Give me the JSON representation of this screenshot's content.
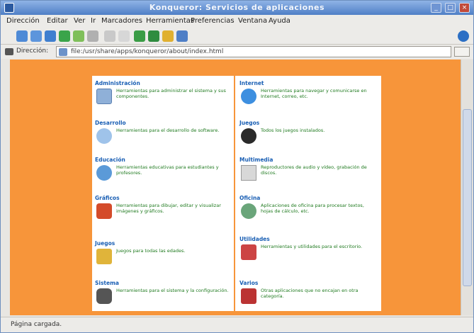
{
  "window": {
    "title": "Konqueror: Servicios de aplicaciones"
  },
  "menubar": [
    "Dirección",
    "Editar",
    "Ver",
    "Ir",
    "Marcadores",
    "Herramientas",
    "Preferencias",
    "Ventana",
    "Ayuda"
  ],
  "locbar": {
    "label": "Dirección:",
    "url": "file:/usr/share/apps/konqueror/about/index.html"
  },
  "left": [
    {
      "title": "Administración",
      "desc": "Herramientas para administrar el sistema y sus componentes.",
      "icon": "admin-icon"
    },
    {
      "title": "Desarrollo",
      "desc": "Herramientas para el desarrollo de software.",
      "icon": "develop-icon"
    },
    {
      "title": "Educación",
      "desc": "Herramientas educativas para estudiantes y profesores.",
      "icon": "education-icon"
    },
    {
      "title": "Gráficos",
      "desc": "Herramientas para dibujar, editar y visualizar imágenes y gráficos.",
      "icon": "graphics-icon"
    },
    {
      "title": "Juegos",
      "desc": "Juegos para todas las edades.",
      "icon": "games-icon"
    },
    {
      "title": "Sistema",
      "desc": "Herramientas para el sistema y la configuración.",
      "icon": "system-icon"
    }
  ],
  "right": [
    {
      "title": "Internet",
      "desc": "Herramientas para navegar y comunicarse en Internet, correo, etc.",
      "icon": "internet-icon"
    },
    {
      "title": "Juegos",
      "desc": "Todos los juegos instalados.",
      "icon": "bomb-icon"
    },
    {
      "title": "Multimedia",
      "desc": "Reproductores de audio y vídeo, grabación de discos.",
      "icon": "multimedia-icon"
    },
    {
      "title": "Oficina",
      "desc": "Aplicaciones de oficina para procesar textos, hojas de cálculo, etc.",
      "icon": "office-icon"
    },
    {
      "title": "Utilidades",
      "desc": "Herramientas y utilidades para el escritorio.",
      "icon": "utility-icon"
    },
    {
      "title": "Varios",
      "desc": "Otras aplicaciones que no encajan en otra categoría.",
      "icon": "misc-icon"
    }
  ],
  "status": {
    "text": "Página cargada."
  },
  "colors": {
    "content_bg": "#f7953a",
    "heading": "#1a5fb4",
    "desc": "#1f7a1f"
  }
}
